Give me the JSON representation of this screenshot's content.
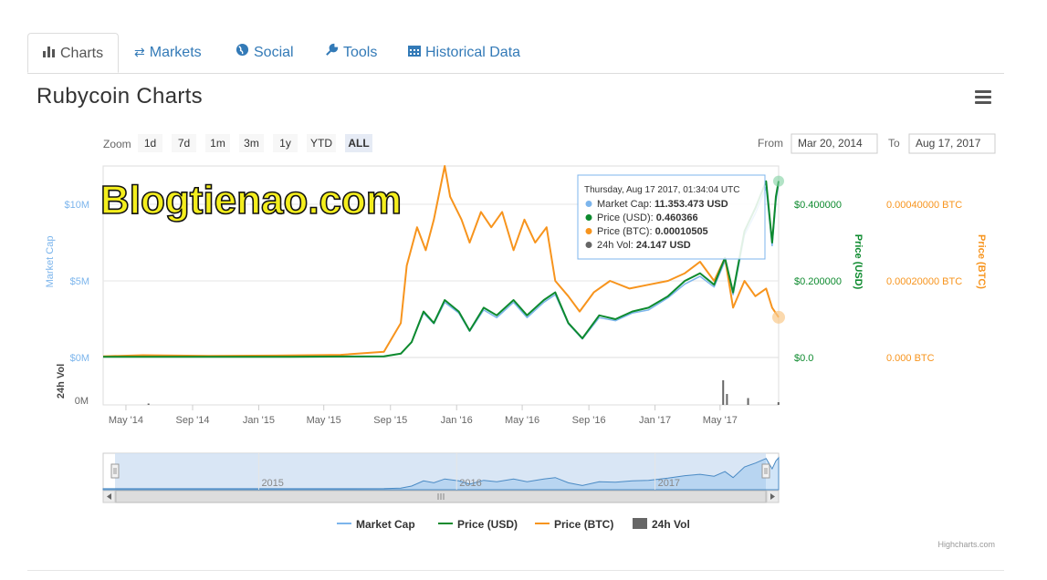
{
  "tabs": [
    {
      "label": "Charts",
      "icon": "bar-chart-icon",
      "glyph": "▮▮",
      "active": true
    },
    {
      "label": "Markets",
      "icon": "exchange-icon",
      "glyph": "⇄",
      "active": false
    },
    {
      "label": "Social",
      "icon": "globe-icon",
      "glyph": "●",
      "active": false
    },
    {
      "label": "Tools",
      "icon": "wrench-icon",
      "glyph": "🔧",
      "active": false
    },
    {
      "label": "Historical Data",
      "icon": "calendar-icon",
      "glyph": "▦",
      "active": false
    }
  ],
  "page_title": "Rubycoin Charts",
  "watermark": "Blogtienao.com",
  "zoom": {
    "label": "Zoom",
    "buttons": [
      "1d",
      "7d",
      "1m",
      "3m",
      "1y",
      "YTD",
      "ALL"
    ],
    "selected": "ALL"
  },
  "range": {
    "from_label": "From",
    "from_value": "Mar 20, 2014",
    "to_label": "To",
    "to_value": "Aug 17, 2017"
  },
  "tooltip": {
    "header": "Thursday, Aug 17 2017, 01:34:04 UTC",
    "rows": [
      {
        "label": "Market Cap:",
        "value": "11.353.473 USD",
        "color": "#7cb5ec"
      },
      {
        "label": "Price (USD):",
        "value": "0.460366",
        "color": "#0d8a2e"
      },
      {
        "label": "Price (BTC):",
        "value": "0.00010505",
        "color": "#f7941d"
      },
      {
        "label": "24h Vol:",
        "value": "24.147 USD",
        "color": "#666666"
      }
    ]
  },
  "legend": [
    {
      "label": "Market Cap",
      "color": "#7cb5ec",
      "kind": "line"
    },
    {
      "label": "Price (USD)",
      "color": "#0d8a2e",
      "kind": "line"
    },
    {
      "label": "Price (BTC)",
      "color": "#f7941d",
      "kind": "line"
    },
    {
      "label": "24h Vol",
      "color": "#666666",
      "kind": "box"
    }
  ],
  "credits": "Highcharts.com",
  "colors": {
    "market_cap": "#7cb5ec",
    "price_usd": "#0d8a2e",
    "price_btc": "#f7941d",
    "volume": "#666666",
    "link": "#337ab7"
  },
  "chart_data": {
    "type": "line",
    "xlabel": "",
    "x_ticks": [
      "May '14",
      "Sep '14",
      "Jan '15",
      "May '15",
      "Sep '15",
      "Jan '16",
      "May '16",
      "Sep '16",
      "Jan '17",
      "May '17"
    ],
    "x_range": [
      "2014-03-20",
      "2017-08-17"
    ],
    "navigator_ticks": [
      "2015",
      "2016",
      "2017"
    ],
    "y_axes": [
      {
        "name": "Market Cap",
        "ticks": [
          "$0M",
          "$5M",
          "$10M"
        ],
        "range": [
          0,
          10
        ],
        "unit": "M USD"
      },
      {
        "name": "Price (USD)",
        "ticks": [
          "$0.0",
          "$0.200000",
          "$0.400000"
        ],
        "range": [
          0,
          0.4
        ]
      },
      {
        "name": "Price (BTC)",
        "ticks": [
          "0.000 BTC",
          "0.00020000 BTC",
          "0.00040000 BTC"
        ],
        "range": [
          0,
          0.0004
        ]
      },
      {
        "name": "24h Vol",
        "ticks": [
          "0M"
        ]
      }
    ],
    "series": [
      {
        "name": "Price (BTC)",
        "axis": "Price (BTC)",
        "points": [
          [
            "2014-03-20",
            3e-06
          ],
          [
            "2014-06-01",
            6e-06
          ],
          [
            "2014-10-01",
            4e-06
          ],
          [
            "2015-02-01",
            5e-06
          ],
          [
            "2015-06-01",
            7e-06
          ],
          [
            "2015-08-20",
            1.5e-05
          ],
          [
            "2015-09-20",
            9e-05
          ],
          [
            "2015-10-01",
            0.00024
          ],
          [
            "2015-10-20",
            0.00034
          ],
          [
            "2015-11-05",
            0.00028
          ],
          [
            "2015-11-20",
            0.00036
          ],
          [
            "2015-12-10",
            0.0005
          ],
          [
            "2015-12-20",
            0.00042
          ],
          [
            "2016-01-10",
            0.00036
          ],
          [
            "2016-01-25",
            0.0003
          ],
          [
            "2016-02-15",
            0.00038
          ],
          [
            "2016-03-05",
            0.00034
          ],
          [
            "2016-03-25",
            0.00038
          ],
          [
            "2016-04-15",
            0.00028
          ],
          [
            "2016-05-05",
            0.00036
          ],
          [
            "2016-05-25",
            0.0003
          ],
          [
            "2016-06-15",
            0.00034
          ],
          [
            "2016-07-01",
            0.0002
          ],
          [
            "2016-07-25",
            0.00016
          ],
          [
            "2016-08-15",
            0.00012
          ],
          [
            "2016-09-10",
            0.00017
          ],
          [
            "2016-10-10",
            0.0002
          ],
          [
            "2016-11-15",
            0.00018
          ],
          [
            "2016-12-20",
            0.00019
          ],
          [
            "2017-01-25",
            0.0002
          ],
          [
            "2017-02-25",
            0.00022
          ],
          [
            "2017-03-25",
            0.00025
          ],
          [
            "2017-04-20",
            0.0002
          ],
          [
            "2017-05-10",
            0.00026
          ],
          [
            "2017-05-25",
            0.00013
          ],
          [
            "2017-06-15",
            0.0002
          ],
          [
            "2017-07-05",
            0.00016
          ],
          [
            "2017-07-25",
            0.00018
          ],
          [
            "2017-08-05",
            0.00013
          ],
          [
            "2017-08-17",
            0.000105
          ]
        ]
      },
      {
        "name": "Price (USD)",
        "axis": "Price (USD)",
        "points": [
          [
            "2014-03-20",
            0.002
          ],
          [
            "2014-09-01",
            0.002
          ],
          [
            "2015-03-01",
            0.002
          ],
          [
            "2015-08-20",
            0.003
          ],
          [
            "2015-09-20",
            0.01
          ],
          [
            "2015-10-10",
            0.04
          ],
          [
            "2015-11-01",
            0.12
          ],
          [
            "2015-11-20",
            0.09
          ],
          [
            "2015-12-10",
            0.15
          ],
          [
            "2016-01-05",
            0.12
          ],
          [
            "2016-01-25",
            0.07
          ],
          [
            "2016-02-20",
            0.13
          ],
          [
            "2016-03-15",
            0.11
          ],
          [
            "2016-04-15",
            0.15
          ],
          [
            "2016-05-10",
            0.11
          ],
          [
            "2016-06-10",
            0.15
          ],
          [
            "2016-07-01",
            0.17
          ],
          [
            "2016-07-25",
            0.09
          ],
          [
            "2016-08-20",
            0.05
          ],
          [
            "2016-09-20",
            0.11
          ],
          [
            "2016-10-20",
            0.1
          ],
          [
            "2016-11-20",
            0.12
          ],
          [
            "2016-12-20",
            0.13
          ],
          [
            "2017-01-25",
            0.16
          ],
          [
            "2017-02-25",
            0.2
          ],
          [
            "2017-03-25",
            0.22
          ],
          [
            "2017-04-20",
            0.19
          ],
          [
            "2017-05-10",
            0.26
          ],
          [
            "2017-05-25",
            0.17
          ],
          [
            "2017-06-15",
            0.33
          ],
          [
            "2017-07-05",
            0.39
          ],
          [
            "2017-07-25",
            0.46
          ],
          [
            "2017-08-05",
            0.3
          ],
          [
            "2017-08-12",
            0.42
          ],
          [
            "2017-08-17",
            0.460366
          ]
        ]
      },
      {
        "name": "Market Cap",
        "axis": "Market Cap",
        "points": [
          [
            "2014-03-20",
            0.04
          ],
          [
            "2014-09-01",
            0.04
          ],
          [
            "2015-03-01",
            0.05
          ],
          [
            "2015-08-20",
            0.07
          ],
          [
            "2015-09-20",
            0.25
          ],
          [
            "2015-10-10",
            1.0
          ],
          [
            "2015-11-01",
            2.9
          ],
          [
            "2015-11-20",
            2.2
          ],
          [
            "2015-12-10",
            3.6
          ],
          [
            "2016-01-05",
            2.9
          ],
          [
            "2016-01-25",
            1.7
          ],
          [
            "2016-02-20",
            3.1
          ],
          [
            "2016-03-15",
            2.6
          ],
          [
            "2016-04-15",
            3.6
          ],
          [
            "2016-05-10",
            2.6
          ],
          [
            "2016-06-10",
            3.6
          ],
          [
            "2016-07-01",
            4.1
          ],
          [
            "2016-07-25",
            2.2
          ],
          [
            "2016-08-20",
            1.2
          ],
          [
            "2016-09-20",
            2.6
          ],
          [
            "2016-10-20",
            2.4
          ],
          [
            "2016-11-20",
            2.9
          ],
          [
            "2016-12-20",
            3.1
          ],
          [
            "2017-01-25",
            3.9
          ],
          [
            "2017-02-25",
            4.8
          ],
          [
            "2017-03-25",
            5.3
          ],
          [
            "2017-04-20",
            4.6
          ],
          [
            "2017-05-10",
            6.3
          ],
          [
            "2017-05-25",
            4.1
          ],
          [
            "2017-06-15",
            8.0
          ],
          [
            "2017-07-05",
            9.4
          ],
          [
            "2017-07-25",
            11.1
          ],
          [
            "2017-08-05",
            7.3
          ],
          [
            "2017-08-12",
            10.2
          ],
          [
            "2017-08-17",
            11.353
          ]
        ]
      }
    ],
    "volume_spikes": [
      [
        "2014-06-10",
        0.05
      ],
      [
        "2017-05-05",
        0.9
      ],
      [
        "2017-05-12",
        0.4
      ],
      [
        "2017-06-20",
        0.25
      ],
      [
        "2017-08-15",
        0.1
      ]
    ],
    "grid": true,
    "legend_position": "bottom"
  }
}
